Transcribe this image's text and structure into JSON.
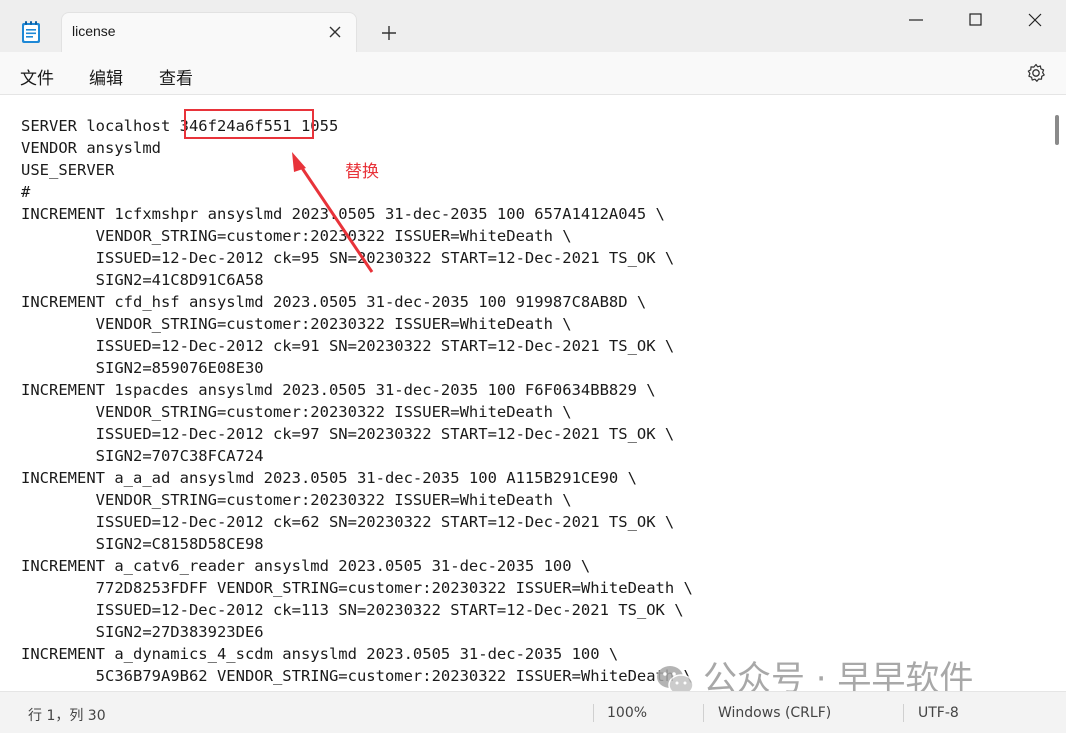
{
  "window": {
    "tab_title": "license"
  },
  "menu": {
    "file": "文件",
    "edit": "编辑",
    "view": "查看"
  },
  "icons": {
    "app": "notepad-icon",
    "tab_close": "close-icon",
    "new_tab": "plus-icon",
    "minimize": "minimize-icon",
    "maximize": "maximize-icon",
    "close": "close-icon",
    "settings": "gear-icon"
  },
  "editor": {
    "lines": [
      "SERVER localhost 346f24a6f551 1055",
      "VENDOR ansyslmd",
      "USE_SERVER",
      "#",
      "INCREMENT 1cfxmshpr ansyslmd 2023.0505 31-dec-2035 100 657A1412A045 \\",
      "        VENDOR_STRING=customer:20230322 ISSUER=WhiteDeath \\",
      "        ISSUED=12-Dec-2012 ck=95 SN=20230322 START=12-Dec-2021 TS_OK \\",
      "        SIGN2=41C8D91C6A58",
      "INCREMENT cfd_hsf ansyslmd 2023.0505 31-dec-2035 100 919987C8AB8D \\",
      "        VENDOR_STRING=customer:20230322 ISSUER=WhiteDeath \\",
      "        ISSUED=12-Dec-2012 ck=91 SN=20230322 START=12-Dec-2021 TS_OK \\",
      "        SIGN2=859076E08E30",
      "INCREMENT 1spacdes ansyslmd 2023.0505 31-dec-2035 100 F6F0634BB829 \\",
      "        VENDOR_STRING=customer:20230322 ISSUER=WhiteDeath \\",
      "        ISSUED=12-Dec-2012 ck=97 SN=20230322 START=12-Dec-2021 TS_OK \\",
      "        SIGN2=707C38FCA724",
      "INCREMENT a_a_ad ansyslmd 2023.0505 31-dec-2035 100 A115B291CE90 \\",
      "        VENDOR_STRING=customer:20230322 ISSUER=WhiteDeath \\",
      "        ISSUED=12-Dec-2012 ck=62 SN=20230322 START=12-Dec-2021 TS_OK \\",
      "        SIGN2=C8158D58CE98",
      "INCREMENT a_catv6_reader ansyslmd 2023.0505 31-dec-2035 100 \\",
      "        772D8253FDFF VENDOR_STRING=customer:20230322 ISSUER=WhiteDeath \\",
      "        ISSUED=12-Dec-2012 ck=113 SN=20230322 START=12-Dec-2021 TS_OK \\",
      "        SIGN2=27D383923DE6",
      "INCREMENT a_dynamics_4_scdm ansyslmd 2023.0505 31-dec-2035 100 \\",
      "        5C36B79A9B62 VENDOR_STRING=customer:20230322 ISSUER=WhiteDeath \\"
    ]
  },
  "annotation": {
    "label": "替换",
    "color": "#e8333a"
  },
  "watermark": {
    "text": "公众号 · 早早软件"
  },
  "status": {
    "position": "行 1，列 30",
    "zoom": "100%",
    "line_ending": "Windows (CRLF)",
    "encoding": "UTF-8"
  }
}
